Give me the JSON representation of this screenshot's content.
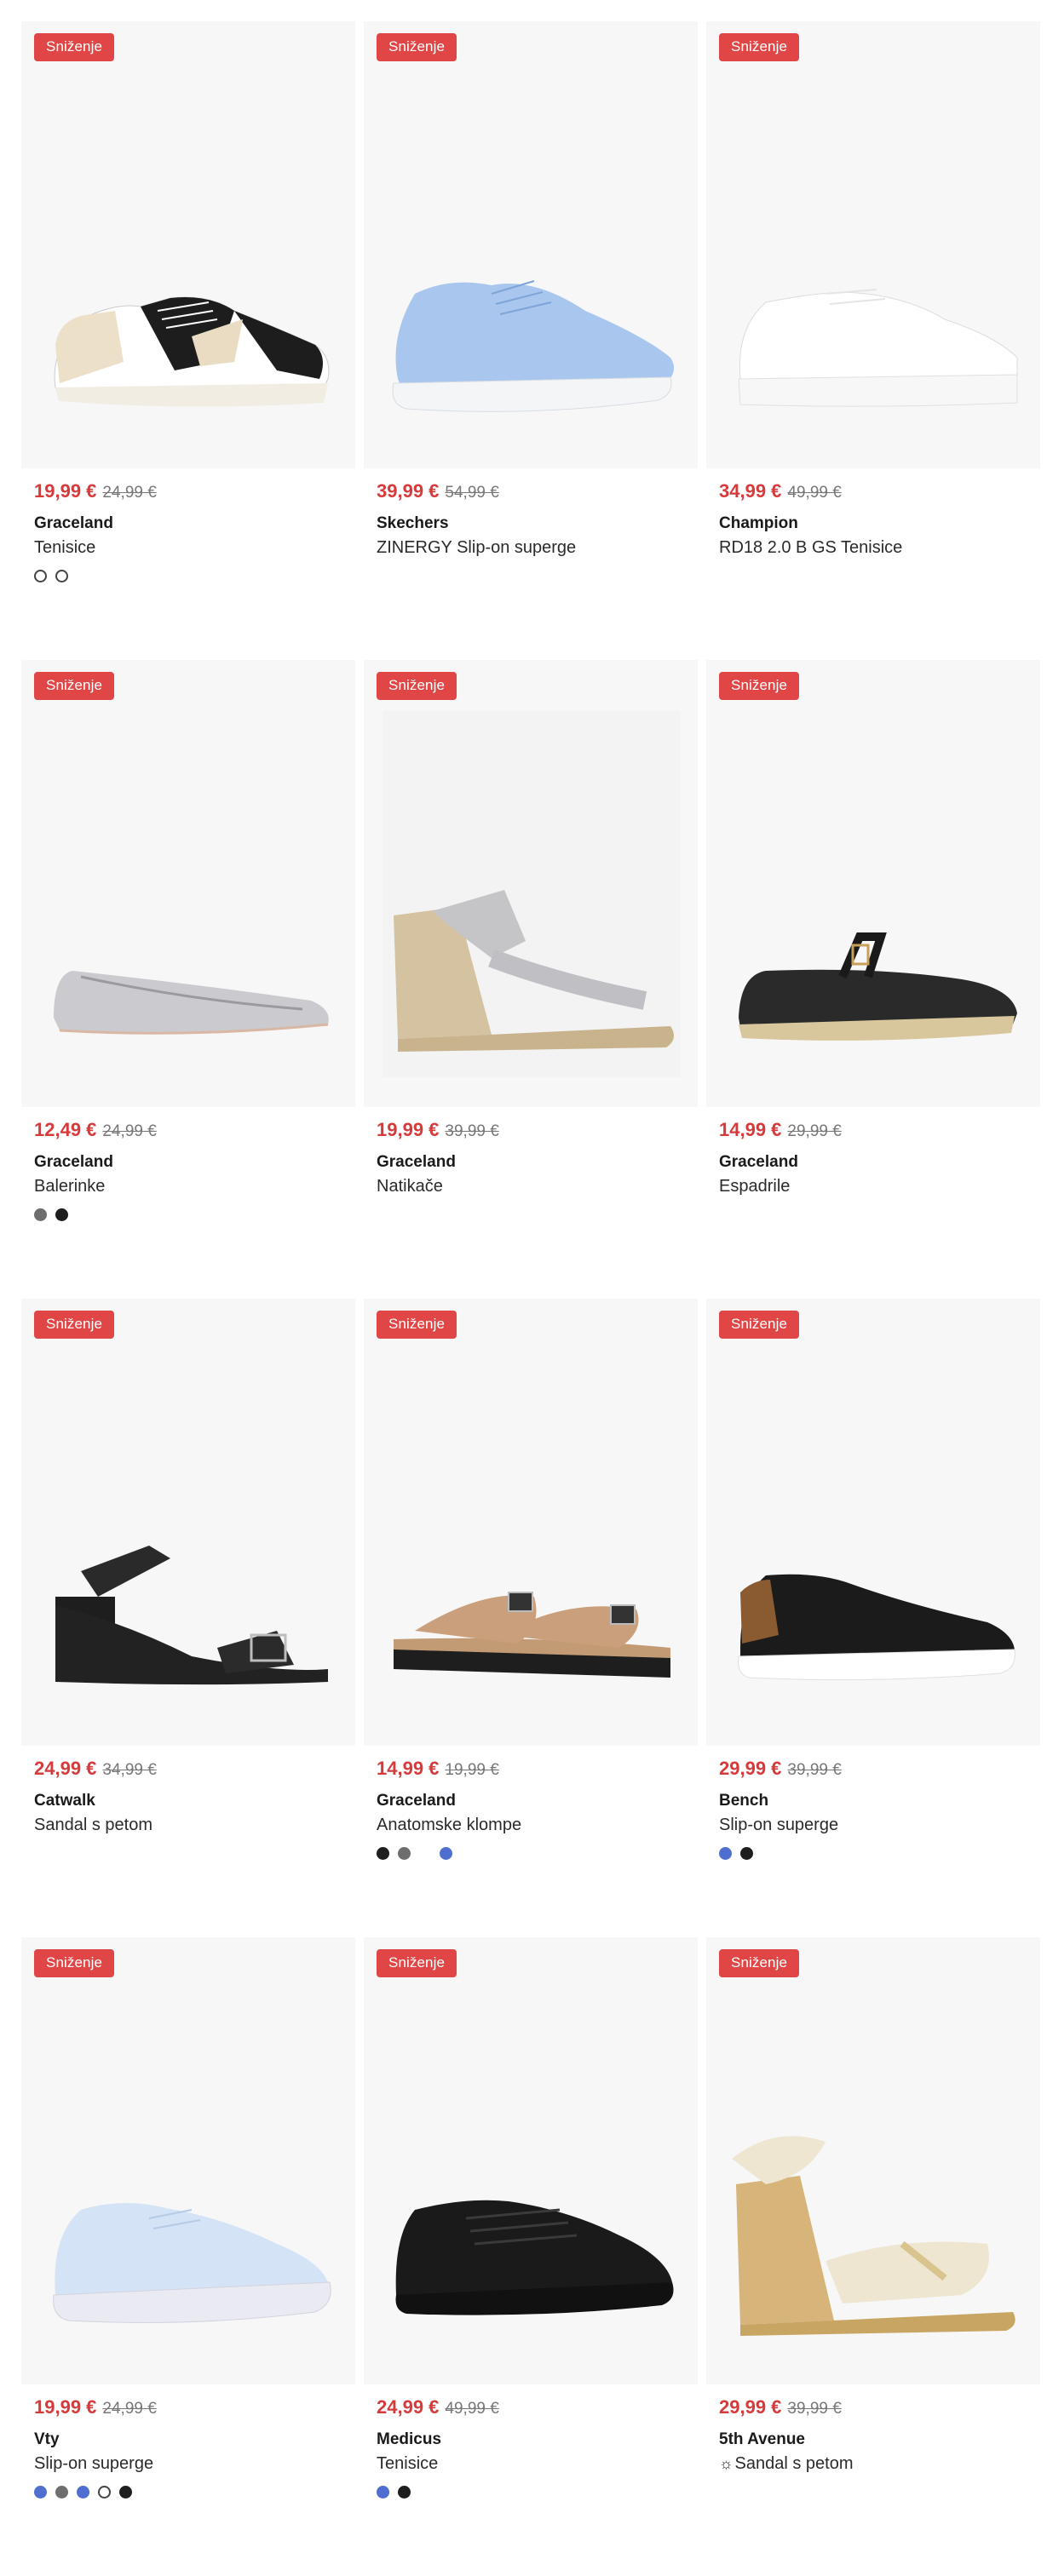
{
  "badge_label": "Sniženje",
  "products": [
    {
      "price": "19,99 €",
      "old_price": "24,99 €",
      "brand": "Graceland",
      "name": "Tenisice",
      "colors": [
        "white",
        "white"
      ]
    },
    {
      "price": "39,99 €",
      "old_price": "54,99 €",
      "brand": "Skechers",
      "name": "ZINERGY Slip-on superge",
      "colors": []
    },
    {
      "price": "34,99 €",
      "old_price": "49,99 €",
      "brand": "Champion",
      "name": "RD18 2.0 B GS Tenisice",
      "colors": []
    },
    {
      "price": "12,49 €",
      "old_price": "24,99 €",
      "brand": "Graceland",
      "name": "Balerinke",
      "colors": [
        "grey",
        "black"
      ]
    },
    {
      "price": "19,99 €",
      "old_price": "39,99 €",
      "brand": "Graceland",
      "name": "Natikače",
      "colors": []
    },
    {
      "price": "14,99 €",
      "old_price": "29,99 €",
      "brand": "Graceland",
      "name": "Espadrile",
      "colors": []
    },
    {
      "price": "24,99 €",
      "old_price": "34,99 €",
      "brand": "Catwalk",
      "name": "Sandal s petom",
      "colors": []
    },
    {
      "price": "14,99 €",
      "old_price": "19,99 €",
      "brand": "Graceland",
      "name": "Anatomske klompe",
      "colors": [
        "black",
        "grey",
        "blue"
      ]
    },
    {
      "price": "29,99 €",
      "old_price": "39,99 €",
      "brand": "Bench",
      "name": "Slip-on superge",
      "colors": [
        "blue",
        "black"
      ]
    },
    {
      "price": "19,99 €",
      "old_price": "24,99 €",
      "brand": "Vty",
      "name": "Slip-on superge",
      "colors": [
        "blue",
        "grey",
        "blue",
        "white",
        "black"
      ]
    },
    {
      "price": "24,99 €",
      "old_price": "49,99 €",
      "brand": "Medicus",
      "name": "Tenisice",
      "colors": [
        "blue",
        "black"
      ]
    },
    {
      "price": "29,99 €",
      "old_price": "39,99 €",
      "brand": "5th Avenue",
      "name": "Sandal s petom",
      "colors": []
    }
  ],
  "theme": {
    "sale_red": "#d63a3a",
    "badge_red": "#e04646",
    "tile_bg": "#f7f7f7"
  }
}
